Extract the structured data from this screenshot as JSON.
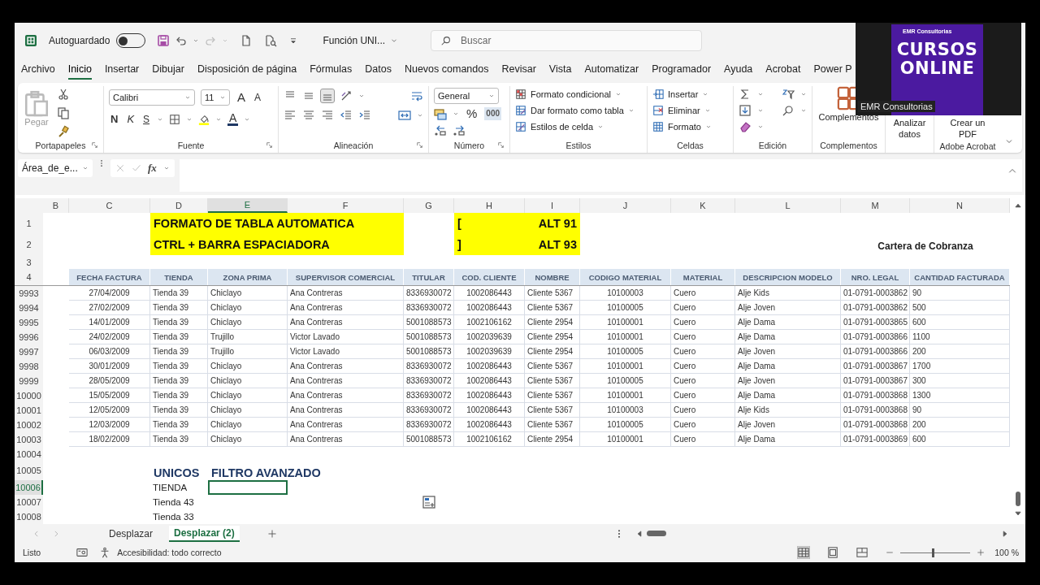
{
  "title_bar": {
    "autosave_label": "Autoguardado",
    "autosave_on": false,
    "file_name": "Función UNI...",
    "search_placeholder": "Buscar"
  },
  "menu_tabs": [
    {
      "label": "Archivo",
      "selected": false
    },
    {
      "label": "Inicio",
      "selected": true
    },
    {
      "label": "Insertar",
      "selected": false
    },
    {
      "label": "Dibujar",
      "selected": false
    },
    {
      "label": "Disposición de página",
      "selected": false
    },
    {
      "label": "Fórmulas",
      "selected": false
    },
    {
      "label": "Datos",
      "selected": false
    },
    {
      "label": "Nuevos comandos",
      "selected": false
    },
    {
      "label": "Revisar",
      "selected": false
    },
    {
      "label": "Vista",
      "selected": false
    },
    {
      "label": "Automatizar",
      "selected": false
    },
    {
      "label": "Programador",
      "selected": false
    },
    {
      "label": "Ayuda",
      "selected": false
    },
    {
      "label": "Acrobat",
      "selected": false
    },
    {
      "label": "Power P",
      "selected": false
    }
  ],
  "ribbon": {
    "clipboard": {
      "paste_label": "Pegar",
      "group_label": "Portapapeles"
    },
    "font": {
      "font_name": "Calibri",
      "font_size": "11",
      "grow_label": "A",
      "shrink_label": "A",
      "bold_label": "N",
      "italic_label": "K",
      "underline_label": "S",
      "color_label": "A",
      "group_label": "Fuente"
    },
    "alignment": {
      "vertical_buttons": [
        {
          "selected": false
        },
        {
          "selected": false
        },
        {
          "selected": true
        }
      ],
      "group_label": "Alineación"
    },
    "number": {
      "format": "General",
      "percent_label": "%",
      "thousands_label": "000",
      "group_label": "Número"
    },
    "styles": {
      "items": [
        "Formato condicional",
        "Dar formato como tabla",
        "Estilos de celda"
      ],
      "group_label": "Estilos"
    },
    "cells": {
      "items": [
        "Insertar",
        "Eliminar",
        "Formato"
      ],
      "group_label": "Celdas"
    },
    "editing": {
      "group_label": "Edición"
    },
    "addins": {
      "label": "Complementos",
      "group_label": "Complementos"
    },
    "analyze": {
      "label": "Analizar datos"
    },
    "acrobat": {
      "label": "Crear un PDF",
      "group_label": "Adobe Acrobat"
    }
  },
  "formula_bar": {
    "name_box": "Área_de_e...",
    "fx_label": "fx"
  },
  "sheet": {
    "columns": [
      {
        "letter": "B",
        "selected": false
      },
      {
        "letter": "C",
        "selected": false
      },
      {
        "letter": "D",
        "selected": false
      },
      {
        "letter": "E",
        "selected": true
      },
      {
        "letter": "F",
        "selected": false
      },
      {
        "letter": "G",
        "selected": false
      },
      {
        "letter": "H",
        "selected": false
      },
      {
        "letter": "I",
        "selected": false
      },
      {
        "letter": "J",
        "selected": false
      },
      {
        "letter": "K",
        "selected": false
      },
      {
        "letter": "L",
        "selected": false
      },
      {
        "letter": "M",
        "selected": false
      },
      {
        "letter": "N",
        "selected": false
      }
    ],
    "rows": [
      {
        "num": "1",
        "kind": "banner",
        "selected": false,
        "title": "FORMATO DE TABLA AUTOMATICA",
        "bracket": "[",
        "shortcut": "ALT 91"
      },
      {
        "num": "2",
        "kind": "banner",
        "selected": false,
        "title": "CTRL + BARRA ESPACIADORA",
        "bracket": "]",
        "shortcut": "ALT 93",
        "note": "Cartera de Cobranza"
      },
      {
        "num": "3",
        "kind": "blank",
        "selected": false
      },
      {
        "num": "4",
        "kind": "header",
        "selected": false,
        "cells": [
          "FECHA FACTURA",
          "TIENDA",
          "ZONA PRIMA",
          "SUPERVISOR COMERCIAL",
          "TITULAR",
          "COD. CLIENTE",
          "NOMBRE",
          "CODIGO MATERIAL",
          "MATERIAL",
          "DESCRIPCION MODELO",
          "NRO. LEGAL",
          "CANTIDAD FACTURADA"
        ]
      },
      {
        "num": "9993",
        "kind": "data",
        "selected": false,
        "cells": [
          "27/04/2009",
          "Tienda 39",
          "Chiclayo",
          "Ana Contreras",
          "8336930072",
          "1002086443",
          "Cliente 5367",
          "10100003",
          "Cuero",
          "Alje Kids",
          "01-0791-0003862",
          "90"
        ]
      },
      {
        "num": "9994",
        "kind": "data",
        "selected": false,
        "cells": [
          "27/02/2009",
          "Tienda 39",
          "Chiclayo",
          "Ana Contreras",
          "8336930072",
          "1002086443",
          "Cliente 5367",
          "10100005",
          "Cuero",
          "Alje Joven",
          "01-0791-0003862",
          "500"
        ]
      },
      {
        "num": "9995",
        "kind": "data",
        "selected": false,
        "cells": [
          "14/01/2009",
          "Tienda 39",
          "Chiclayo",
          "Ana Contreras",
          "5001088573",
          "1002106162",
          "Cliente 2954",
          "10100001",
          "Cuero",
          "Alje Dama",
          "01-0791-0003865",
          "600"
        ]
      },
      {
        "num": "9996",
        "kind": "data",
        "selected": false,
        "cells": [
          "24/02/2009",
          "Tienda 39",
          "Trujillo",
          "Victor Lavado",
          "5001088573",
          "1002039639",
          "Cliente 2954",
          "10100001",
          "Cuero",
          "Alje Dama",
          "01-0791-0003866",
          "1100"
        ]
      },
      {
        "num": "9997",
        "kind": "data",
        "selected": false,
        "cells": [
          "06/03/2009",
          "Tienda 39",
          "Trujillo",
          "Victor Lavado",
          "5001088573",
          "1002039639",
          "Cliente 2954",
          "10100005",
          "Cuero",
          "Alje Joven",
          "01-0791-0003866",
          "200"
        ]
      },
      {
        "num": "9998",
        "kind": "data",
        "selected": false,
        "cells": [
          "30/01/2009",
          "Tienda 39",
          "Chiclayo",
          "Ana Contreras",
          "8336930072",
          "1002086443",
          "Cliente 5367",
          "10100001",
          "Cuero",
          "Alje Dama",
          "01-0791-0003867",
          "1700"
        ]
      },
      {
        "num": "9999",
        "kind": "data",
        "selected": false,
        "cells": [
          "28/05/2009",
          "Tienda 39",
          "Chiclayo",
          "Ana Contreras",
          "8336930072",
          "1002086443",
          "Cliente 5367",
          "10100005",
          "Cuero",
          "Alje Joven",
          "01-0791-0003867",
          "300"
        ]
      },
      {
        "num": "10000",
        "kind": "data",
        "selected": false,
        "cells": [
          "15/05/2009",
          "Tienda 39",
          "Chiclayo",
          "Ana Contreras",
          "8336930072",
          "1002086443",
          "Cliente 5367",
          "10100001",
          "Cuero",
          "Alje Dama",
          "01-0791-0003868",
          "1300"
        ]
      },
      {
        "num": "10001",
        "kind": "data",
        "selected": false,
        "cells": [
          "12/05/2009",
          "Tienda 39",
          "Chiclayo",
          "Ana Contreras",
          "8336930072",
          "1002086443",
          "Cliente 5367",
          "10100003",
          "Cuero",
          "Alje Kids",
          "01-0791-0003868",
          "90"
        ]
      },
      {
        "num": "10002",
        "kind": "data",
        "selected": false,
        "cells": [
          "12/03/2009",
          "Tienda 39",
          "Chiclayo",
          "Ana Contreras",
          "8336930072",
          "1002086443",
          "Cliente 5367",
          "10100005",
          "Cuero",
          "Alje Joven",
          "01-0791-0003868",
          "200"
        ]
      },
      {
        "num": "10003",
        "kind": "data",
        "selected": false,
        "cells": [
          "18/02/2009",
          "Tienda 39",
          "Chiclayo",
          "Ana Contreras",
          "5001088573",
          "1002106162",
          "Cliente 2954",
          "10100001",
          "Cuero",
          "Alje Dama",
          "01-0791-0003869",
          "600"
        ]
      },
      {
        "num": "10004",
        "kind": "blank",
        "selected": false
      },
      {
        "num": "10005",
        "kind": "heading",
        "selected": false,
        "cells": [
          "UNICOS",
          "FILTRO AVANZADO"
        ]
      },
      {
        "num": "10006",
        "kind": "input",
        "selected": true,
        "cells": [
          "TIENDA"
        ]
      },
      {
        "num": "10007",
        "kind": "label",
        "selected": false,
        "cells": [
          "Tienda 43"
        ]
      },
      {
        "num": "10008",
        "kind": "label",
        "selected": false,
        "cells": [
          "Tienda 33"
        ]
      }
    ]
  },
  "sheet_tabs": [
    {
      "label": "Desplazar",
      "selected": false
    },
    {
      "label": "Desplazar (2)",
      "selected": true
    }
  ],
  "status_bar": {
    "ready": "Listo",
    "accessibility": "Accesibilidad: todo correcto",
    "views": [
      {
        "selected": true
      },
      {
        "selected": false
      },
      {
        "selected": false
      }
    ],
    "zoom_slider": {
      "level": 0.45
    },
    "zoom": "100 %"
  },
  "overlay": {
    "brand": "EMR Consultorias",
    "title": [
      "CURSOS",
      "ONLINE"
    ],
    "caption": "EMR Consultorias"
  }
}
